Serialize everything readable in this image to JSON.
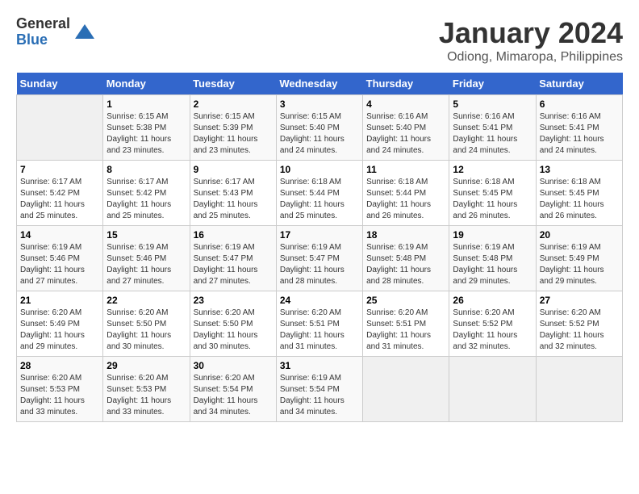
{
  "logo": {
    "general": "General",
    "blue": "Blue"
  },
  "title": "January 2024",
  "subtitle": "Odiong, Mimaropa, Philippines",
  "headers": [
    "Sunday",
    "Monday",
    "Tuesday",
    "Wednesday",
    "Thursday",
    "Friday",
    "Saturday"
  ],
  "weeks": [
    [
      {
        "day": "",
        "sunrise": "",
        "sunset": "",
        "daylight": ""
      },
      {
        "day": "1",
        "sunrise": "Sunrise: 6:15 AM",
        "sunset": "Sunset: 5:38 PM",
        "daylight": "Daylight: 11 hours and 23 minutes."
      },
      {
        "day": "2",
        "sunrise": "Sunrise: 6:15 AM",
        "sunset": "Sunset: 5:39 PM",
        "daylight": "Daylight: 11 hours and 23 minutes."
      },
      {
        "day": "3",
        "sunrise": "Sunrise: 6:15 AM",
        "sunset": "Sunset: 5:40 PM",
        "daylight": "Daylight: 11 hours and 24 minutes."
      },
      {
        "day": "4",
        "sunrise": "Sunrise: 6:16 AM",
        "sunset": "Sunset: 5:40 PM",
        "daylight": "Daylight: 11 hours and 24 minutes."
      },
      {
        "day": "5",
        "sunrise": "Sunrise: 6:16 AM",
        "sunset": "Sunset: 5:41 PM",
        "daylight": "Daylight: 11 hours and 24 minutes."
      },
      {
        "day": "6",
        "sunrise": "Sunrise: 6:16 AM",
        "sunset": "Sunset: 5:41 PM",
        "daylight": "Daylight: 11 hours and 24 minutes."
      }
    ],
    [
      {
        "day": "7",
        "sunrise": "Sunrise: 6:17 AM",
        "sunset": "Sunset: 5:42 PM",
        "daylight": "Daylight: 11 hours and 25 minutes."
      },
      {
        "day": "8",
        "sunrise": "Sunrise: 6:17 AM",
        "sunset": "Sunset: 5:42 PM",
        "daylight": "Daylight: 11 hours and 25 minutes."
      },
      {
        "day": "9",
        "sunrise": "Sunrise: 6:17 AM",
        "sunset": "Sunset: 5:43 PM",
        "daylight": "Daylight: 11 hours and 25 minutes."
      },
      {
        "day": "10",
        "sunrise": "Sunrise: 6:18 AM",
        "sunset": "Sunset: 5:44 PM",
        "daylight": "Daylight: 11 hours and 25 minutes."
      },
      {
        "day": "11",
        "sunrise": "Sunrise: 6:18 AM",
        "sunset": "Sunset: 5:44 PM",
        "daylight": "Daylight: 11 hours and 26 minutes."
      },
      {
        "day": "12",
        "sunrise": "Sunrise: 6:18 AM",
        "sunset": "Sunset: 5:45 PM",
        "daylight": "Daylight: 11 hours and 26 minutes."
      },
      {
        "day": "13",
        "sunrise": "Sunrise: 6:18 AM",
        "sunset": "Sunset: 5:45 PM",
        "daylight": "Daylight: 11 hours and 26 minutes."
      }
    ],
    [
      {
        "day": "14",
        "sunrise": "Sunrise: 6:19 AM",
        "sunset": "Sunset: 5:46 PM",
        "daylight": "Daylight: 11 hours and 27 minutes."
      },
      {
        "day": "15",
        "sunrise": "Sunrise: 6:19 AM",
        "sunset": "Sunset: 5:46 PM",
        "daylight": "Daylight: 11 hours and 27 minutes."
      },
      {
        "day": "16",
        "sunrise": "Sunrise: 6:19 AM",
        "sunset": "Sunset: 5:47 PM",
        "daylight": "Daylight: 11 hours and 27 minutes."
      },
      {
        "day": "17",
        "sunrise": "Sunrise: 6:19 AM",
        "sunset": "Sunset: 5:47 PM",
        "daylight": "Daylight: 11 hours and 28 minutes."
      },
      {
        "day": "18",
        "sunrise": "Sunrise: 6:19 AM",
        "sunset": "Sunset: 5:48 PM",
        "daylight": "Daylight: 11 hours and 28 minutes."
      },
      {
        "day": "19",
        "sunrise": "Sunrise: 6:19 AM",
        "sunset": "Sunset: 5:48 PM",
        "daylight": "Daylight: 11 hours and 29 minutes."
      },
      {
        "day": "20",
        "sunrise": "Sunrise: 6:19 AM",
        "sunset": "Sunset: 5:49 PM",
        "daylight": "Daylight: 11 hours and 29 minutes."
      }
    ],
    [
      {
        "day": "21",
        "sunrise": "Sunrise: 6:20 AM",
        "sunset": "Sunset: 5:49 PM",
        "daylight": "Daylight: 11 hours and 29 minutes."
      },
      {
        "day": "22",
        "sunrise": "Sunrise: 6:20 AM",
        "sunset": "Sunset: 5:50 PM",
        "daylight": "Daylight: 11 hours and 30 minutes."
      },
      {
        "day": "23",
        "sunrise": "Sunrise: 6:20 AM",
        "sunset": "Sunset: 5:50 PM",
        "daylight": "Daylight: 11 hours and 30 minutes."
      },
      {
        "day": "24",
        "sunrise": "Sunrise: 6:20 AM",
        "sunset": "Sunset: 5:51 PM",
        "daylight": "Daylight: 11 hours and 31 minutes."
      },
      {
        "day": "25",
        "sunrise": "Sunrise: 6:20 AM",
        "sunset": "Sunset: 5:51 PM",
        "daylight": "Daylight: 11 hours and 31 minutes."
      },
      {
        "day": "26",
        "sunrise": "Sunrise: 6:20 AM",
        "sunset": "Sunset: 5:52 PM",
        "daylight": "Daylight: 11 hours and 32 minutes."
      },
      {
        "day": "27",
        "sunrise": "Sunrise: 6:20 AM",
        "sunset": "Sunset: 5:52 PM",
        "daylight": "Daylight: 11 hours and 32 minutes."
      }
    ],
    [
      {
        "day": "28",
        "sunrise": "Sunrise: 6:20 AM",
        "sunset": "Sunset: 5:53 PM",
        "daylight": "Daylight: 11 hours and 33 minutes."
      },
      {
        "day": "29",
        "sunrise": "Sunrise: 6:20 AM",
        "sunset": "Sunset: 5:53 PM",
        "daylight": "Daylight: 11 hours and 33 minutes."
      },
      {
        "day": "30",
        "sunrise": "Sunrise: 6:20 AM",
        "sunset": "Sunset: 5:54 PM",
        "daylight": "Daylight: 11 hours and 34 minutes."
      },
      {
        "day": "31",
        "sunrise": "Sunrise: 6:19 AM",
        "sunset": "Sunset: 5:54 PM",
        "daylight": "Daylight: 11 hours and 34 minutes."
      },
      {
        "day": "",
        "sunrise": "",
        "sunset": "",
        "daylight": ""
      },
      {
        "day": "",
        "sunrise": "",
        "sunset": "",
        "daylight": ""
      },
      {
        "day": "",
        "sunrise": "",
        "sunset": "",
        "daylight": ""
      }
    ]
  ]
}
